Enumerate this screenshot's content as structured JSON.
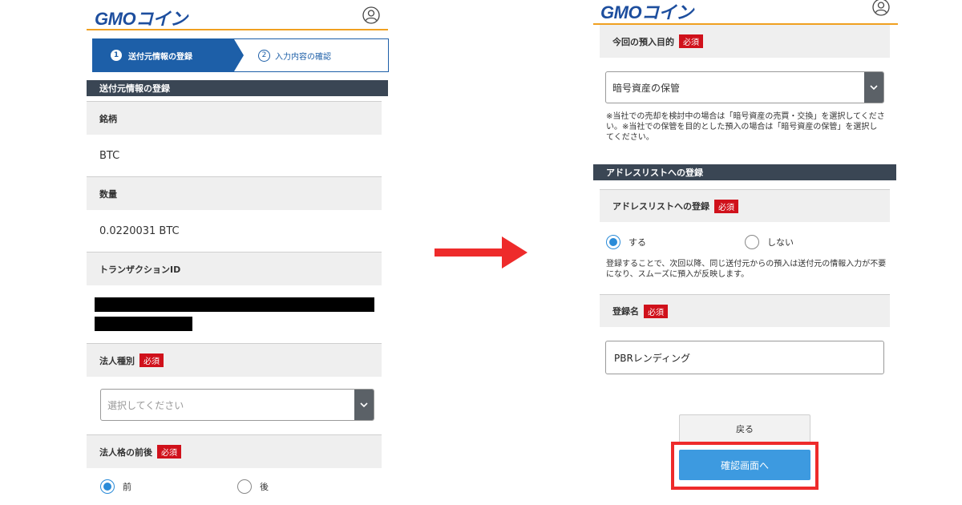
{
  "brand": {
    "logo_gmo": "GMO",
    "logo_coin": "コイン"
  },
  "left": {
    "steps": {
      "step1_num": "1",
      "step1_label": "送付元情報の登録",
      "step2_num": "2",
      "step2_label": "入力内容の確認"
    },
    "section_title": "送付元情報の登録",
    "fields": {
      "symbol_label": "銘柄",
      "symbol_value": "BTC",
      "amount_label": "数量",
      "amount_value": "0.0220031 BTC",
      "txid_label": "トランザクションID",
      "entity_type_label": "法人種別",
      "entity_type_placeholder": "選択してください",
      "entity_position_label": "法人格の前後",
      "entity_position_opt1": "前",
      "entity_position_opt2": "後"
    },
    "required_badge": "必須"
  },
  "right": {
    "purpose_label": "今回の預入目的",
    "purpose_value": "暗号資産の保管",
    "purpose_note": "※当社での売却を検討中の場合は「暗号資産の売買・交換」を選択してください。※当社での保管を目的とした預入の場合は「暗号資産の保管」を選択してください。",
    "address_section_title": "アドレスリストへの登録",
    "address_label": "アドレスリストへの登録",
    "address_opt_yes": "する",
    "address_opt_no": "しない",
    "address_note": "登録することで、次回以降、同じ送付元からの預入は送付元の情報入力が不要になり、スムーズに預入が反映します。",
    "reg_name_label": "登録名",
    "reg_name_value": "PBRレンディング",
    "back_button": "戻る",
    "confirm_button": "確認画面へ",
    "required_badge": "必須"
  },
  "colors": {
    "accent_blue": "#1d5fa8",
    "header_orange": "#f0a020",
    "required_red": "#d0111b",
    "highlight_red": "#ee2b2b",
    "confirm_blue": "#3d9ae0",
    "section_dark": "#3a4654"
  },
  "icons": {
    "user": "user-circle-icon",
    "dropdown": "chevron-down-icon",
    "flow": "right-arrow-icon"
  }
}
